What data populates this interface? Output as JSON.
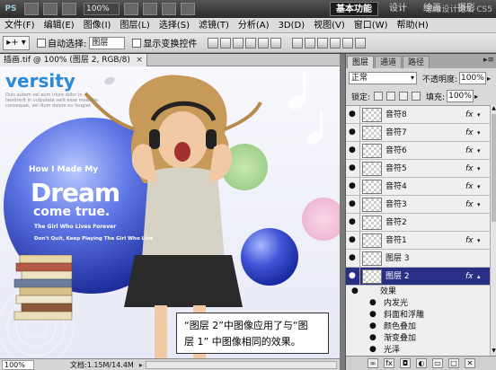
{
  "appbar": {
    "logo": "PS",
    "zoom": "100%",
    "workspace_essentials": "基本功能",
    "workspace_design": "设计",
    "workspace_painting": "绘画",
    "workspace_photo": "摄影",
    "watermark": "思缘设计论坛 CS5"
  },
  "menubar": {
    "items": [
      "文件(F)",
      "编辑(E)",
      "图像(I)",
      "图层(L)",
      "选择(S)",
      "滤镜(T)",
      "分析(A)",
      "3D(D)",
      "视图(V)",
      "窗口(W)",
      "帮助(H)"
    ]
  },
  "options": {
    "tool_preset": "▸+ ▾",
    "auto_select_label": "自动选择:",
    "auto_select_value": "图层",
    "show_transform_label": "显示变换控件"
  },
  "document": {
    "tab_title": "插画.tif @ 100% (图层 2, RGB/8)",
    "close": "×"
  },
  "canvas_text": {
    "versity": "versity",
    "tagline": "Duis autem vel eum iriure dolor in hendrerit in vulputate velit esse molestie consequat, vel illum dolore eu feugiat",
    "how_made": "How I Made My",
    "dream": "Dream",
    "come_true": "come true.",
    "lives_forever": "The Girl Who Lives Forever",
    "dont_quit": "Don't Quit, Keep Playing The Girl Who Live"
  },
  "caption": {
    "line1": "“图层 2”中图像应用了与“图",
    "line2": "层 1” 中图像相同的效果。"
  },
  "status": {
    "zoom": "100%",
    "doc_info": "文档:1.15M/14.4M",
    "arrow": "▸"
  },
  "layers_panel": {
    "tabs": [
      "图层",
      "通道",
      "路径"
    ],
    "menu_icon": "▸≡",
    "blend_mode": "正常",
    "opacity_label": "不透明度:",
    "opacity_value": "100%",
    "lock_label": "锁定:",
    "fill_label": "填充:",
    "fill_value": "100%",
    "layers": [
      {
        "name": "音符8",
        "fx": "fx",
        "selected": false
      },
      {
        "name": "音符7",
        "fx": "fx",
        "selected": false
      },
      {
        "name": "音符6",
        "fx": "fx",
        "selected": false
      },
      {
        "name": "音符5",
        "fx": "fx",
        "selected": false
      },
      {
        "name": "音符4",
        "fx": "fx",
        "selected": false
      },
      {
        "name": "音符3",
        "fx": "fx",
        "selected": false
      },
      {
        "name": "音符2",
        "fx": "",
        "selected": false
      },
      {
        "name": "音符1",
        "fx": "fx",
        "selected": false
      },
      {
        "name": "图层 3",
        "fx": "",
        "selected": false
      },
      {
        "name": "图层 2",
        "fx": "fx",
        "selected": true
      }
    ],
    "effects_label": "效果",
    "effects": [
      "内发光",
      "斜面和浮雕",
      "颜色叠加",
      "渐变叠加",
      "光泽"
    ]
  },
  "colors": {
    "selected_layer": "#2a2f86",
    "brand_blue": "#2a8ad8",
    "sphere_blue": "#3a4fcf"
  }
}
